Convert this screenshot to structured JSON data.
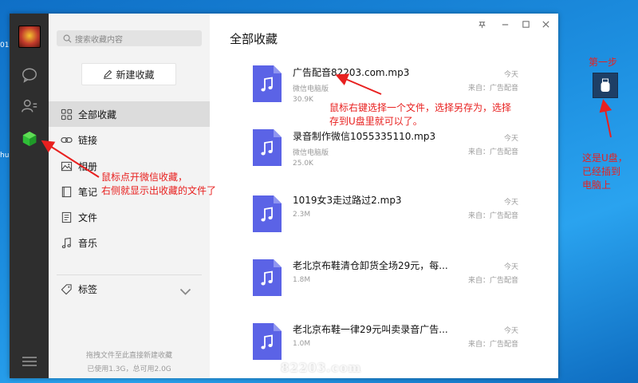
{
  "desktop": {
    "left_text_1": "01",
    "left_text_2": "hu"
  },
  "sidebar": {
    "search_placeholder": "搜索收藏内容",
    "new_button": "新建收藏",
    "items": [
      {
        "label": "全部收藏",
        "icon": "grid-icon"
      },
      {
        "label": "链接",
        "icon": "link-icon"
      },
      {
        "label": "相册",
        "icon": "image-icon"
      },
      {
        "label": "笔记",
        "icon": "note-icon"
      },
      {
        "label": "文件",
        "icon": "file-icon"
      },
      {
        "label": "音乐",
        "icon": "music-icon"
      }
    ],
    "tags_label": "标签",
    "footer_hint": "拖拽文件至此直接新建收藏",
    "footer_usage": "已使用1.3G，总可用2.0G"
  },
  "main": {
    "title": "全部收藏",
    "files": [
      {
        "name": "广告配音82203.com.mp3",
        "sub": "微信电脑版",
        "size": "30.9K",
        "time": "今天",
        "source": "来自：广告配音"
      },
      {
        "name": "录音制作微信1055335110.mp3",
        "sub": "微信电脑版",
        "size": "25.0K",
        "time": "今天",
        "source": "来自：广告配音"
      },
      {
        "name": "1019女3走过路过2.mp3",
        "sub": "",
        "size": "2.3M",
        "time": "今天",
        "source": "来自：广告配音"
      },
      {
        "name": "老北京布鞋清仓卸货全场29元，每...",
        "sub": "",
        "size": "1.8M",
        "time": "今天",
        "source": "来自：广告配音"
      },
      {
        "name": "老北京布鞋一律29元叫卖录音广告...",
        "sub": "",
        "size": "1.0M",
        "time": "今天",
        "source": "来自：广告配音"
      }
    ]
  },
  "watermark": "82203.com",
  "annotations": {
    "left_line1": "鼠标点开微信收藏，",
    "left_line2": "右侧就显示出收藏的文件了",
    "right_line1": "鼠标右键选择一个文件，选择另存为，选择",
    "right_line2": "存到U盘里就可以了。",
    "step": "第一步",
    "usb_line1": "这是U盘，",
    "usb_line2": "已经插到",
    "usb_line3": "电脑上"
  },
  "colors": {
    "accent_red": "#e8201f",
    "file_icon": "#5b63e6",
    "sidebar_active": "#dcdcdc"
  }
}
